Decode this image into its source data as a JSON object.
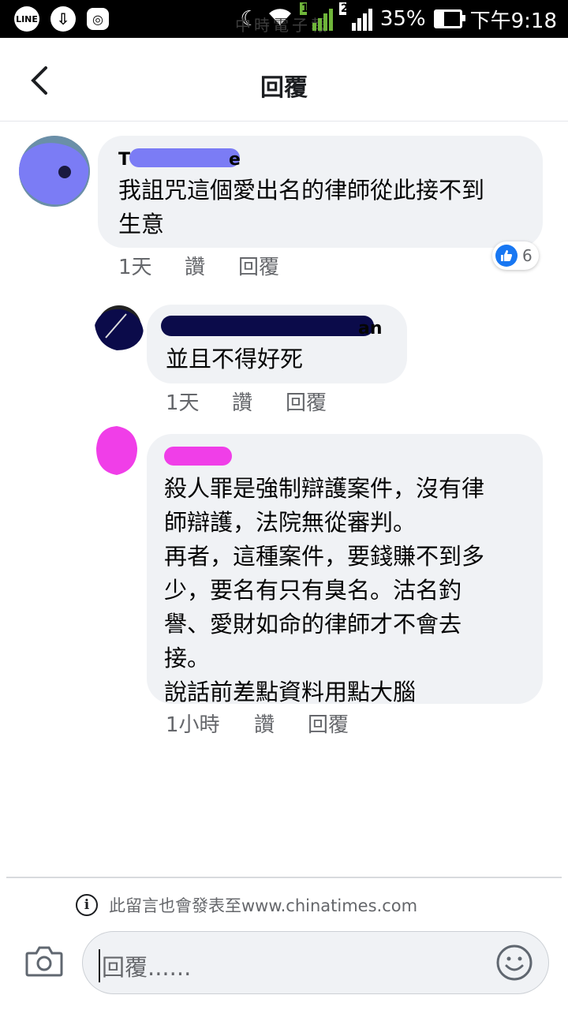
{
  "status_bar": {
    "battery": "35%",
    "time": "下午9:18",
    "sim1": "1",
    "sim2": "2",
    "line_label": "LINE",
    "ghost_text": "中時電子報"
  },
  "header": {
    "title": "回覆"
  },
  "comments": [
    {
      "author_initial": "T",
      "author_tail": "e",
      "text": "我詛咒這個愛出名的律師從此接不到\n生意",
      "time": "1天",
      "like_label": "讚",
      "reply_label": "回覆",
      "reaction_count": "6"
    },
    {
      "author_tail": "an",
      "text": "並且不得好死",
      "time": "1天",
      "like_label": "讚",
      "reply_label": "回覆"
    },
    {
      "text": "殺人罪是強制辯護案件，沒有律\n師辯護，法院無從審判。\n再者，這種案件，要錢賺不到多\n少，要名有只有臭名。沽名釣\n譽、愛財如命的律師才不會去\n接。\n說話前差點資料用點大腦",
      "time": "1小時",
      "like_label": "讚",
      "reply_label": "回覆"
    }
  ],
  "footer": {
    "notice": "此留言也會發表至www.chinatimes.com",
    "input_placeholder": "回覆......"
  },
  "colors": {
    "bubble": "#f0f2f5",
    "meta_text": "#65676b",
    "like_blue": "#1877f2",
    "redact_blue": "#7b7cf5",
    "redact_navy": "#0b0b4a",
    "redact_magenta": "#f03ee8"
  },
  "icons": [
    "line-icon",
    "download-icon",
    "instagram-icon",
    "moon-icon",
    "wifi-icon",
    "signal-icon",
    "battery-icon",
    "back-arrow-icon",
    "thumbs-up-icon",
    "info-icon",
    "camera-icon",
    "emoji-icon"
  ]
}
